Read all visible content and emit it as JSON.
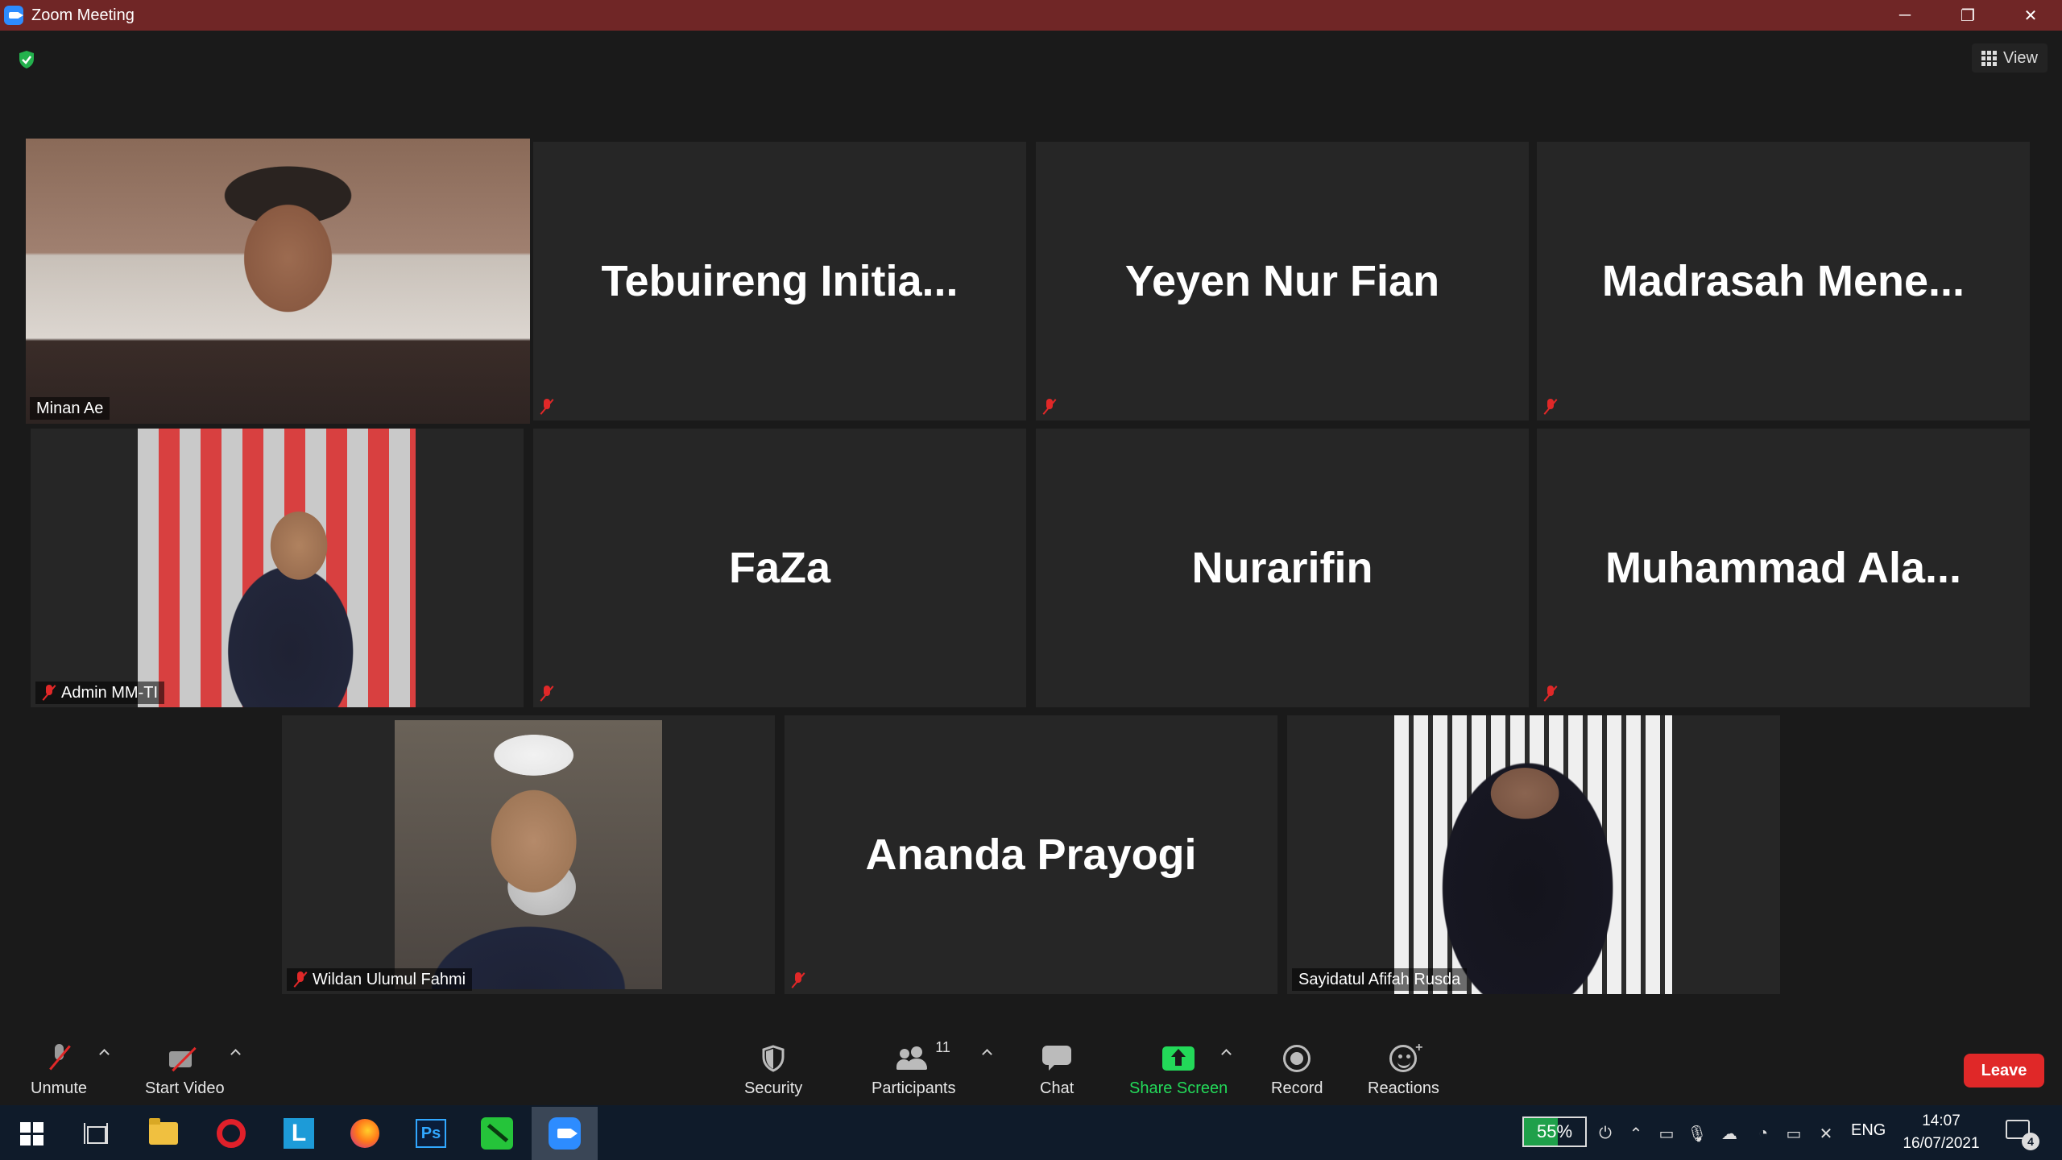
{
  "window": {
    "title": "Zoom Meeting",
    "minimize": "─",
    "restore": "❐",
    "close": "✕"
  },
  "view_button": {
    "label": "View"
  },
  "participants": [
    {
      "name": "Minan Ae",
      "muted": false,
      "video": true,
      "active_speaker": true
    },
    {
      "name": "Tebuireng  Initia...",
      "muted": true,
      "video": false
    },
    {
      "name": "Yeyen Nur Fian",
      "muted": true,
      "video": false
    },
    {
      "name": "Madrasah  Mene...",
      "muted": true,
      "video": false
    },
    {
      "name": "Admin MM-TI",
      "muted": true,
      "video": true
    },
    {
      "name": "FaZa",
      "muted": true,
      "video": false
    },
    {
      "name": "Nurarifin",
      "muted": false,
      "video": false
    },
    {
      "name": "Muhammad  Ala...",
      "muted": true,
      "video": false
    },
    {
      "name": "Wildan Ulumul Fahmi",
      "muted": true,
      "video": true
    },
    {
      "name": "Ananda Prayogi",
      "muted": true,
      "video": false
    },
    {
      "name": "Sayidatul Afifah Rusda",
      "muted": false,
      "video": true
    }
  ],
  "toolbar": {
    "unmute": "Unmute",
    "start_video": "Start Video",
    "security": "Security",
    "participants": "Participants",
    "participants_count": "11",
    "chat": "Chat",
    "share_screen": "Share Screen",
    "record": "Record",
    "reactions": "Reactions",
    "leave": "Leave"
  },
  "taskbar": {
    "apps": [
      "start",
      "task-view",
      "file-explorer",
      "opera",
      "l-app",
      "firefox",
      "photoshop",
      "green-app",
      "zoom"
    ],
    "l_app_letter": "L",
    "ps_letters": "Ps",
    "battery_percent": "55%",
    "battery_fraction": 0.55,
    "language": "ENG",
    "time": "14:07",
    "date": "16/07/2021",
    "notifications": "4"
  },
  "colors": {
    "titlebar": "#702626",
    "active_speaker_border": "#f3ed6e",
    "muted": "#e02828",
    "share_green": "#23d959",
    "leave_red": "#e02828"
  }
}
